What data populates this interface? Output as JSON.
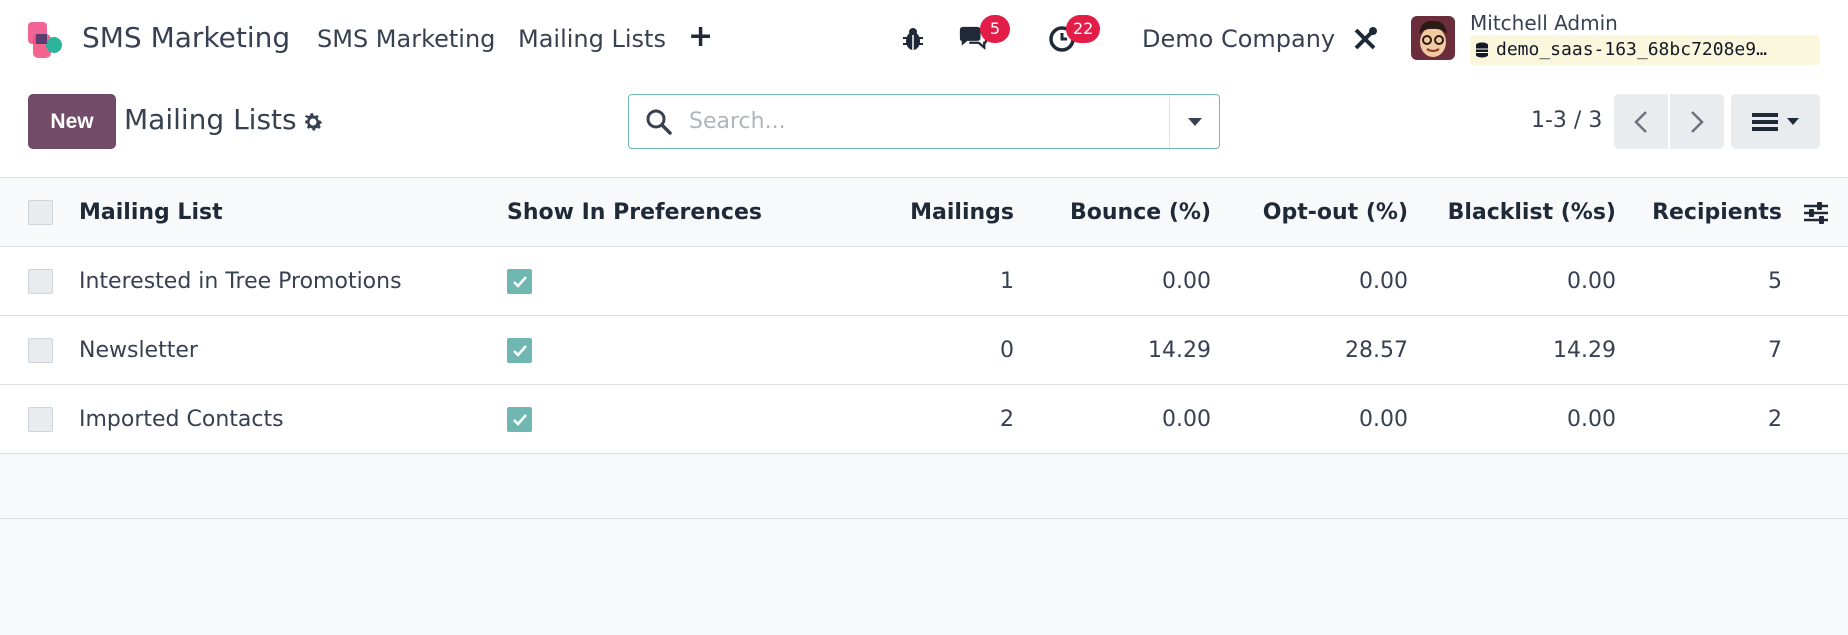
{
  "navbar": {
    "app_name": "SMS Marketing",
    "menu": [
      "SMS Marketing",
      "Mailing Lists"
    ],
    "add_icon": "plus-icon",
    "debug_icon": "bug-icon",
    "messages_icon": "chat-icon",
    "messages_count": "5",
    "activities_icon": "clock-icon",
    "activities_count": "22",
    "company": "Demo Company",
    "tools_icon": "tools-icon",
    "user_name": "Mitchell Admin",
    "database": "demo_saas-163_68bc7208e9…"
  },
  "control_panel": {
    "new_label": "New",
    "title": "Mailing Lists",
    "settings_icon": "gear-icon",
    "search_placeholder": "Search...",
    "pager": "1-3 / 3",
    "view_icon": "list-view-icon"
  },
  "table": {
    "columns": [
      "Mailing List",
      "Show In Preferences",
      "Mailings",
      "Bounce (%)",
      "Opt-out (%)",
      "Blacklist (%s)",
      "Recipients"
    ],
    "rows": [
      {
        "name": "Interested in Tree Promotions",
        "show_in_preferences": true,
        "mailings": "1",
        "bounce": "0.00",
        "optout": "0.00",
        "blacklist": "0.00",
        "recipients": "5"
      },
      {
        "name": "Newsletter",
        "show_in_preferences": true,
        "mailings": "0",
        "bounce": "14.29",
        "optout": "28.57",
        "blacklist": "14.29",
        "recipients": "7"
      },
      {
        "name": "Imported Contacts",
        "show_in_preferences": true,
        "mailings": "2",
        "bounce": "0.00",
        "optout": "0.00",
        "blacklist": "0.00",
        "recipients": "2"
      }
    ]
  },
  "colors": {
    "brand": "#714b67",
    "accent": "#71b7b1",
    "badge": "#e11d48"
  }
}
